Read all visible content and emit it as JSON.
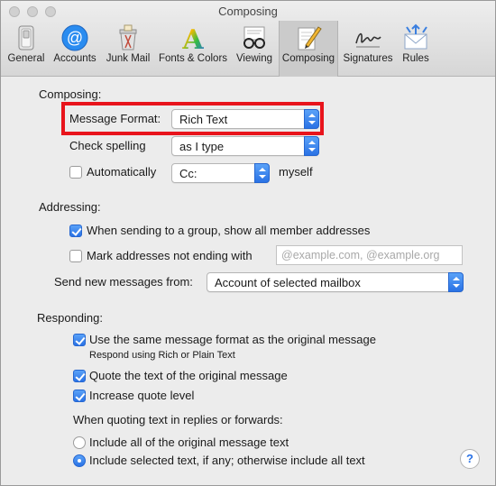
{
  "window": {
    "title": "Composing"
  },
  "toolbar": {
    "items": [
      {
        "label": "General",
        "icon": "switch-icon"
      },
      {
        "label": "Accounts",
        "icon": "at-sign-icon"
      },
      {
        "label": "Junk Mail",
        "icon": "trash-bin-icon"
      },
      {
        "label": "Fonts & Colors",
        "icon": "font-a-icon"
      },
      {
        "label": "Viewing",
        "icon": "glasses-icon"
      },
      {
        "label": "Composing",
        "icon": "pencil-icon",
        "selected": true
      },
      {
        "label": "Signatures",
        "icon": "signature-icon"
      },
      {
        "label": "Rules",
        "icon": "envelope-arrows-icon"
      }
    ]
  },
  "composing": {
    "section_title": "Composing:",
    "message_format_label": "Message Format:",
    "message_format_value": "Rich Text",
    "check_spelling_label": "Check spelling",
    "check_spelling_value": "as I type",
    "automatically_label": "Automatically",
    "automatically_checked": false,
    "cc_value": "Cc:",
    "myself_label": "myself"
  },
  "addressing": {
    "section_title": "Addressing:",
    "group_label": "When sending to a group, show all member addresses",
    "group_checked": true,
    "mark_label": "Mark addresses not ending with",
    "mark_checked": false,
    "mark_placeholder": "@example.com, @example.org",
    "send_from_label": "Send new messages from:",
    "send_from_value": "Account of selected mailbox"
  },
  "responding": {
    "section_title": "Responding:",
    "same_format_label": "Use the same message format as the original message",
    "same_format_checked": true,
    "same_format_sub": "Respond using Rich or Plain Text",
    "quote_label": "Quote the text of the original message",
    "quote_checked": true,
    "increase_label": "Increase quote level",
    "increase_checked": true,
    "quoting_heading": "When quoting text in replies or forwards:",
    "include_all_label": "Include all of the original message text",
    "include_selected_label": "Include selected text, if any; otherwise include all text",
    "selected_option": "include_selected"
  },
  "help": {
    "label": "?"
  },
  "colors": {
    "accent": "#2a72e5",
    "highlight": "#e8141c"
  }
}
